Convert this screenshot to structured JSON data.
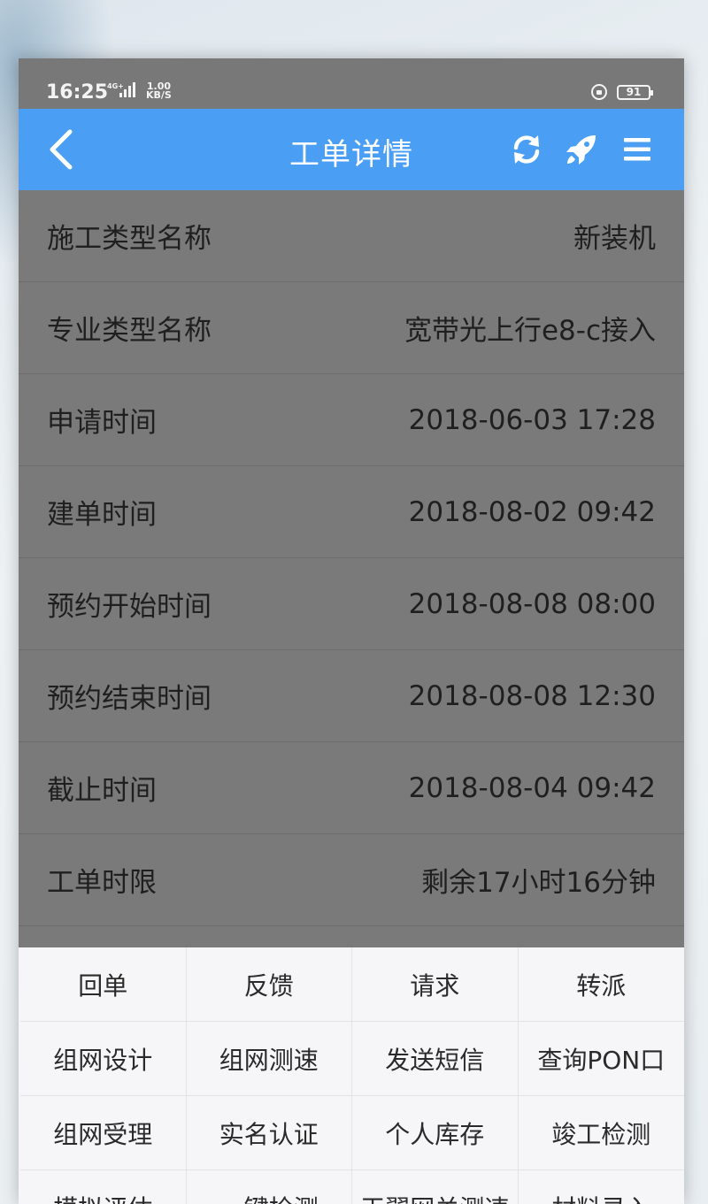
{
  "status_bar": {
    "time": "16:25",
    "network": "4G+",
    "speed_value": "1.00",
    "speed_unit": "KB/S",
    "battery": "91"
  },
  "header": {
    "title": "工单详情",
    "back_icon": "chevron-left-icon",
    "refresh_icon": "refresh-icon",
    "rocket_icon": "rocket-icon",
    "menu_icon": "hamburger-menu-icon",
    "background_color": "#4a9ff5"
  },
  "details": [
    {
      "label": "施工类型名称",
      "value": "新装机"
    },
    {
      "label": "专业类型名称",
      "value": "宽带光上行e8-c接入"
    },
    {
      "label": "申请时间",
      "value": "2018-06-03 17:28"
    },
    {
      "label": "建单时间",
      "value": "2018-08-02 09:42"
    },
    {
      "label": "预约开始时间",
      "value": "2018-08-08 08:00"
    },
    {
      "label": "预约结束时间",
      "value": "2018-08-08 12:30"
    },
    {
      "label": "截止时间",
      "value": "2018-08-04 09:42"
    },
    {
      "label": "工单时限",
      "value": "剩余17小时16分钟"
    }
  ],
  "actions": [
    "回单",
    "反馈",
    "请求",
    "转派",
    "组网设计",
    "组网测速",
    "发送短信",
    "查询PON口",
    "组网受理",
    "实名认证",
    "个人库存",
    "竣工检测",
    "模拟评估",
    "一键检测",
    "天翼网关测速",
    "材料录入"
  ]
}
